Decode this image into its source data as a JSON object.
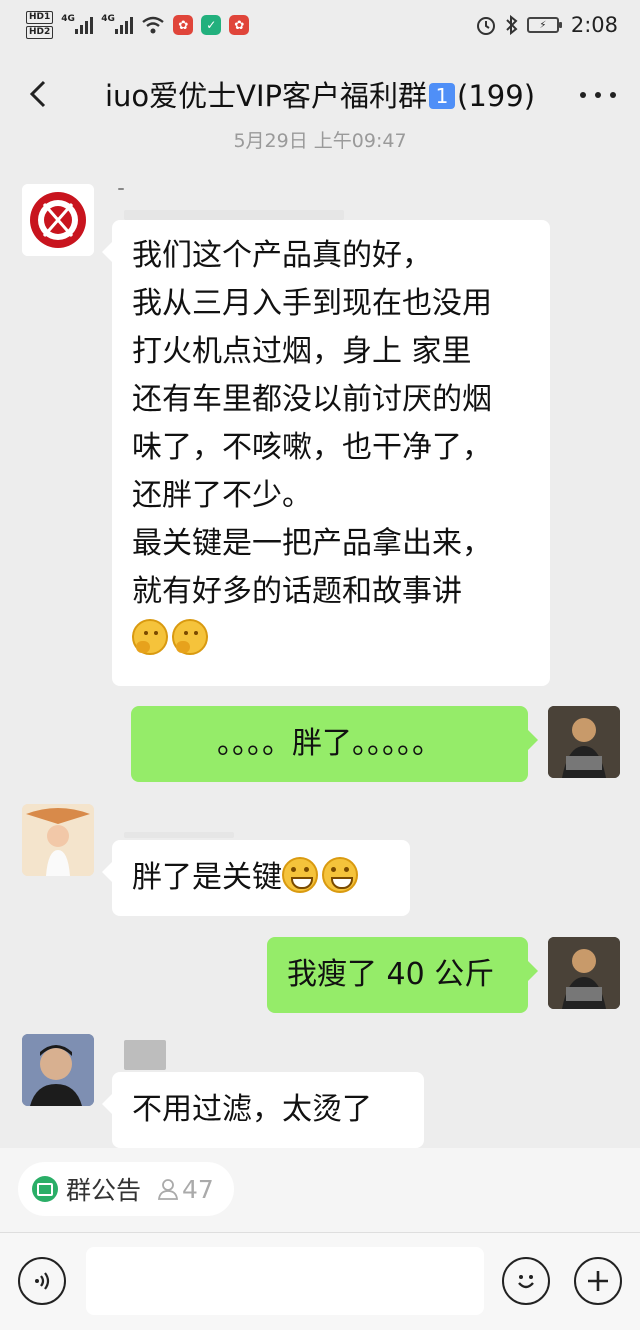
{
  "status_bar": {
    "hd1": "HD1",
    "hd2": "HD2",
    "net1": "4G",
    "net2": "4G",
    "time": "2:08"
  },
  "header": {
    "title_prefix": "iuo爱优士VIP客户福利群",
    "title_keycap": "1",
    "title_suffix": "(199)"
  },
  "timestamp": "5月29日 上午09:47",
  "messages": [
    {
      "side": "in",
      "lines": [
        "我们这个产品真的好，",
        "我从三月入手到现在也没用",
        "打火机点过烟，身上 家里",
        "还有车里都没以前讨厌的烟",
        "味了，不咳嗽，也干净了，",
        "还胖了不少。",
        "最关键是一把产品拿出来，",
        "就有好多的话题和故事讲"
      ],
      "emojis": [
        "thinking-face",
        "thinking-face"
      ]
    },
    {
      "side": "out",
      "text": "。。。。胖了。。。。。"
    },
    {
      "side": "in",
      "text": "胖了是关键",
      "emojis": [
        "grinning-squint-face",
        "grinning-squint-face"
      ]
    },
    {
      "side": "out",
      "text": "我瘦了 40 公斤"
    },
    {
      "side": "in",
      "text": "不用过滤，太烫了"
    }
  ],
  "announcement": {
    "label": "群公告",
    "count": "47"
  },
  "input": {
    "placeholder": ""
  },
  "colors": {
    "background": "#ededed",
    "incoming_bubble": "#ffffff",
    "outgoing_bubble": "#95ec69",
    "timestamp": "#9a9a9a"
  }
}
